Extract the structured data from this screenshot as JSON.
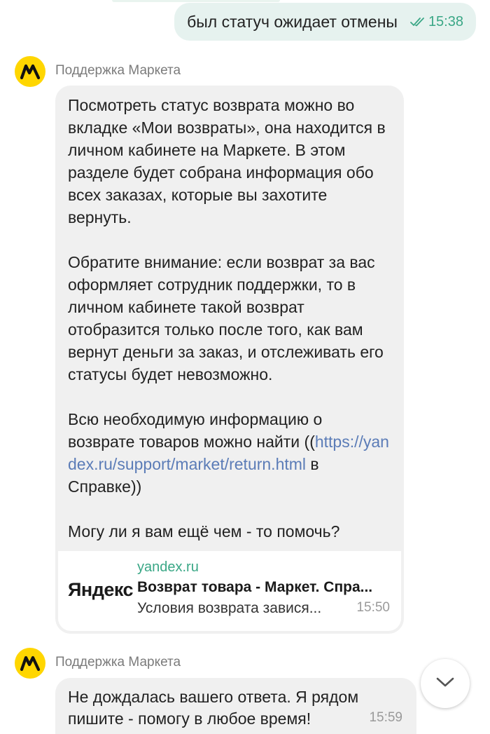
{
  "outgoing": {
    "text": "был статуч ожидает отмены",
    "time": "15:38"
  },
  "messages": [
    {
      "sender": "Поддержка Маркета",
      "paragraphs": [
        "Посмотреть статус возврата можно во вкладке «Мои возвраты», она находится в личном кабинете на Маркете. В этом разделе будет собрана информация обо всех заказах, которые вы захотите вернуть.",
        "Обратите внимание: если возврат за вас оформляет сотрудник поддержки, то в личном кабинете такой возврат отобразится только после того, как вам вернут деньги за заказ, и отслеживать его статусы будет невозможно.",
        "Всю необходимую информацию о возврате товаров можно найти ((",
        "Могу ли я вам ещё чем - то помочь?"
      ],
      "link_url": "https://yandex.ru/support/market/return.html",
      "link_suffix": " в Справке))",
      "preview": {
        "logo_text": "Яндекс",
        "domain": "yandex.ru",
        "title": "Возврат товара - Маркет. Спра...",
        "description": "Условия возврата завися...",
        "time": "15:50"
      }
    },
    {
      "sender": "Поддержка Маркета",
      "text": "Не дождалась вашего ответа. Я рядом пишите - помогу в любое время!",
      "time": "15:59"
    }
  ],
  "icons": {
    "read_status": "double-check-icon",
    "avatar": "yandex-market-logo-icon",
    "scroll_down": "chevron-down-icon"
  },
  "colors": {
    "outgoing_bubble": "#e6f2ef",
    "incoming_bubble": "#f0f0f0",
    "accent_green": "#3aa786",
    "link": "#5b7cb7",
    "avatar_yellow": "#ffd600"
  }
}
